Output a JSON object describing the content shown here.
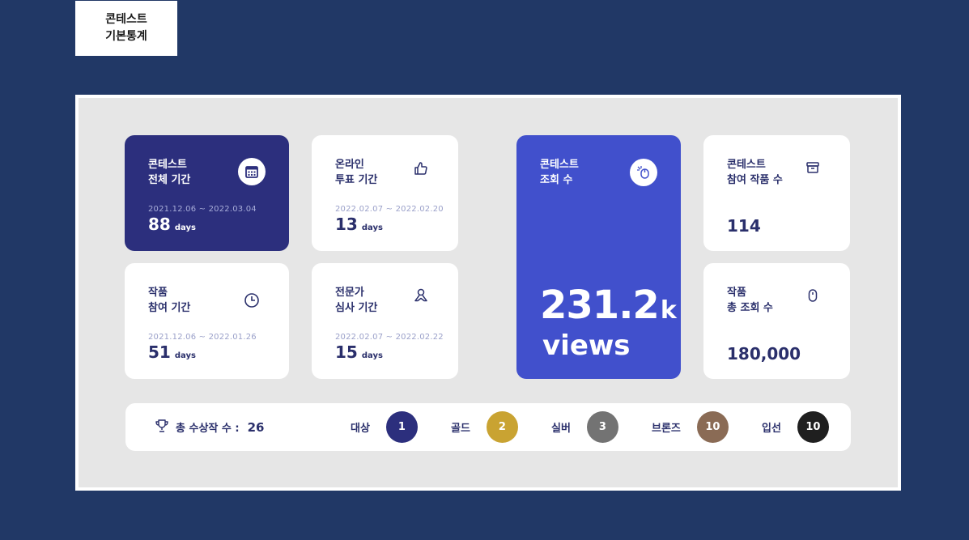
{
  "header": {
    "title_line1": "콘테스트",
    "title_line2": "기본통계"
  },
  "cards": {
    "contest_period": {
      "title": "콘테스트\n전체 기간",
      "date": "2021.12.06 ~ 2022.03.04",
      "value": "88",
      "unit": "days",
      "icon": "calendar-icon"
    },
    "vote_period": {
      "title": "온라인\n투표 기간",
      "date": "2022.02.07 ~ 2022.02.20",
      "value": "13",
      "unit": "days",
      "icon": "thumbs-up-icon"
    },
    "entry_period": {
      "title": "작품\n참여 기간",
      "date": "2021.12.06 ~ 2022.01.26",
      "value": "51",
      "unit": "days",
      "icon": "clock-icon"
    },
    "judge_period": {
      "title": "전문가\n심사 기간",
      "date": "2022.02.07 ~ 2022.02.22",
      "value": "15",
      "unit": "days",
      "icon": "person-icon"
    },
    "contest_views": {
      "title": "콘테스트\n조회 수",
      "value": "231.2",
      "suffix": "k",
      "label": "views",
      "icon": "mouse-click-icon"
    },
    "entries": {
      "title": "콘테스트\n참여 작품 수",
      "value": "114",
      "icon": "archive-icon"
    },
    "work_views": {
      "title": "작품\n총 조회 수",
      "value": "180,000",
      "icon": "mouse-icon"
    }
  },
  "awards": {
    "total_label": "총 수상작 수 :",
    "total_value": "26",
    "icon": "trophy-icon",
    "items": [
      {
        "label": "대상",
        "count": "1",
        "color": "#2c2f7d"
      },
      {
        "label": "골드",
        "count": "2",
        "color": "#c9a332"
      },
      {
        "label": "실버",
        "count": "3",
        "color": "#737373"
      },
      {
        "label": "브론즈",
        "count": "10",
        "color": "#8a6b55"
      },
      {
        "label": "입선",
        "count": "10",
        "color": "#1f1f1f"
      }
    ]
  },
  "colors": {
    "background": "#213866",
    "panel": "#e6e6e6",
    "dark_card": "#2c2f7d",
    "blue_card": "#4150cc",
    "text": "#2a2f6b"
  }
}
